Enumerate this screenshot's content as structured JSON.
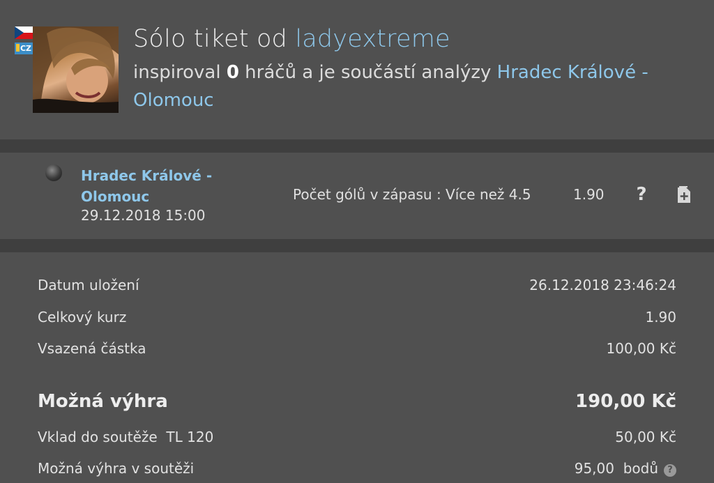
{
  "header": {
    "title_prefix": "Sólo tiket od",
    "username": "ladyextreme",
    "flag_badge": "CZ",
    "subtitle_part1": "inspiroval",
    "inspired_count": "0",
    "subtitle_part2": "hráčů a je součástí analýzy",
    "analysis_link": "Hradec Králové - Olomouc"
  },
  "match": {
    "name": "Hradec Králové - Olomouc",
    "datetime": "29.12.2018 15:00",
    "bet": "Počet gólů v zápasu : Více než 4.5",
    "odds": "1.90",
    "help_label": "?",
    "icons": {
      "status": "ball-icon",
      "help": "question-icon",
      "action": "document-add-icon"
    }
  },
  "summary": {
    "rows": [
      {
        "label": "Datum uložení",
        "value": "26.12.2018 23:46:24"
      },
      {
        "label": "Celkový kurz",
        "value": "1.90"
      },
      {
        "label": "Vsazená částka",
        "value": "100,00 Kč"
      }
    ],
    "possible_win": {
      "label": "Možná výhra",
      "value": "190,00 Kč"
    },
    "contest_deposit": {
      "label": "Vklad do soutěže  TL 120",
      "value": "50,00 Kč"
    },
    "contest_win": {
      "label": "Možná výhra v soutěži",
      "value": "95,00  bodů",
      "help_label": "?"
    }
  },
  "colors": {
    "background": "#505050",
    "separator": "#3f3f3f",
    "link": "#8ec7ea",
    "text": "#e2e2e2"
  }
}
